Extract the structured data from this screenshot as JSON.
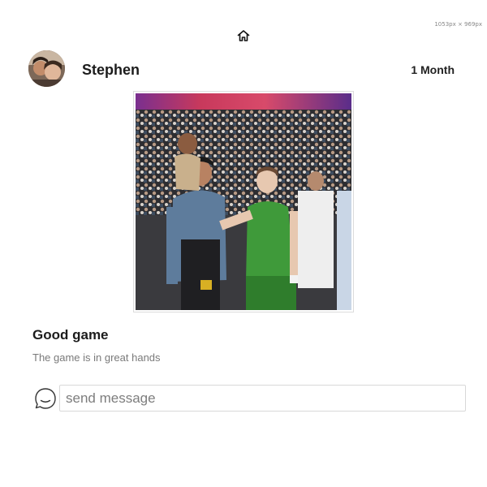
{
  "viewport_label": "1053px × 969px",
  "nav": {
    "home_icon": "home-icon"
  },
  "post": {
    "author": {
      "name": "Stephen",
      "avatar_icon": "user-avatar"
    },
    "age": "1 Month",
    "image": {
      "alt": "Good game"
    },
    "title": "Good game",
    "caption": "The game is in great hands"
  },
  "comment": {
    "icon": "chat-bubble-icon",
    "placeholder": "send message",
    "value": ""
  },
  "colors": {
    "text_primary": "#1c1c1c",
    "text_muted": "#7a7a7a",
    "border": "#d8d8d8",
    "jersey_green": "#3f9a3a"
  }
}
